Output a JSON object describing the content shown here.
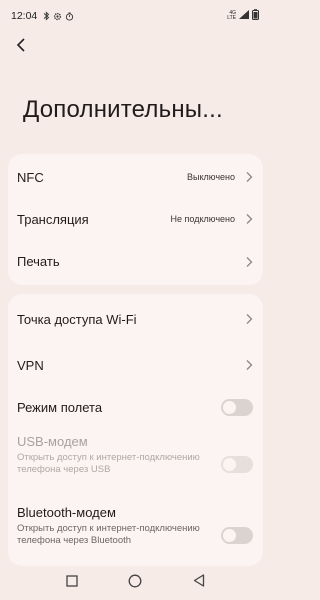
{
  "status_bar": {
    "time": "12:04",
    "network": "4G",
    "network_sub": "LTE",
    "icons": [
      "bluetooth-icon",
      "gear-icon",
      "timer-icon",
      "signal-icon",
      "battery-icon"
    ]
  },
  "page": {
    "title": "Дополнительны..."
  },
  "card1": {
    "items": [
      {
        "label": "NFC",
        "value": "Выключено"
      },
      {
        "label": "Трансляция",
        "value": "Не подключено"
      },
      {
        "label": "Печать"
      }
    ]
  },
  "card2": {
    "hotspot": {
      "label": "Точка доступа Wi-Fi"
    },
    "vpn": {
      "label": "VPN"
    },
    "airplane": {
      "label": "Режим полета",
      "state": "off"
    },
    "usb": {
      "label": "USB-модем",
      "subtitle": "Открыть доступ к интернет-подключению телефона через USB",
      "state": "off"
    },
    "bluetooth": {
      "label": "Bluetooth-модем",
      "subtitle": "Открыть доступ к интернет-подключению телефона через Bluetooth",
      "state": "off"
    }
  },
  "colors": {
    "background": "#f6ebe7",
    "card": "#fbf4f2",
    "toggle_off": "#dcd3d0"
  },
  "nav": {
    "icons": [
      "recent-apps-icon",
      "home-icon",
      "back-icon"
    ]
  }
}
